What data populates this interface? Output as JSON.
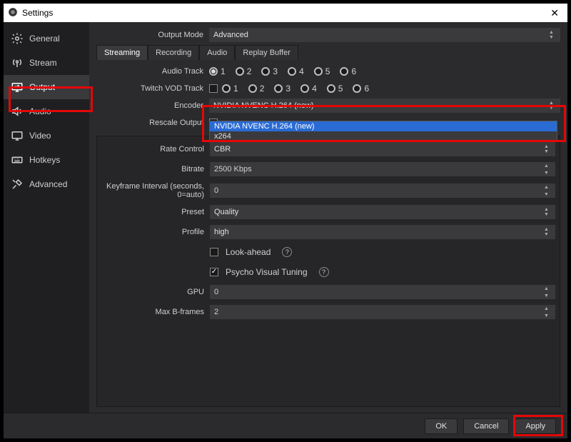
{
  "window": {
    "title": "Settings"
  },
  "sidebar": {
    "items": [
      {
        "label": "General"
      },
      {
        "label": "Stream"
      },
      {
        "label": "Output"
      },
      {
        "label": "Audio"
      },
      {
        "label": "Video"
      },
      {
        "label": "Hotkeys"
      },
      {
        "label": "Advanced"
      }
    ]
  },
  "topRow": {
    "outputModeLabel": "Output Mode",
    "outputModeValue": "Advanced"
  },
  "tabs": {
    "streaming": "Streaming",
    "recording": "Recording",
    "audio": "Audio",
    "replay": "Replay Buffer"
  },
  "tracks": {
    "audioLabel": "Audio Track",
    "twitchLabel": "Twitch VOD Track",
    "opts": [
      "1",
      "2",
      "3",
      "4",
      "5",
      "6"
    ]
  },
  "encoder": {
    "label": "Encoder",
    "value": "NVIDIA NVENC H.264 (new)",
    "options": [
      "NVIDIA NVENC H.264 (new)",
      "x264"
    ]
  },
  "rescale": {
    "label": "Rescale Output"
  },
  "panel": {
    "rateControlLabel": "Rate Control",
    "rateControlValue": "CBR",
    "bitrateLabel": "Bitrate",
    "bitrateValue": "2500 Kbps",
    "keyframeLabel": "Keyframe Interval (seconds, 0=auto)",
    "keyframeValue": "0",
    "presetLabel": "Preset",
    "presetValue": "Quality",
    "profileLabel": "Profile",
    "profileValue": "high",
    "lookaheadLabel": "Look-ahead",
    "psychoLabel": "Psycho Visual Tuning",
    "gpuLabel": "GPU",
    "gpuValue": "0",
    "maxBLabel": "Max B-frames",
    "maxBValue": "2"
  },
  "footer": {
    "ok": "OK",
    "cancel": "Cancel",
    "apply": "Apply"
  }
}
